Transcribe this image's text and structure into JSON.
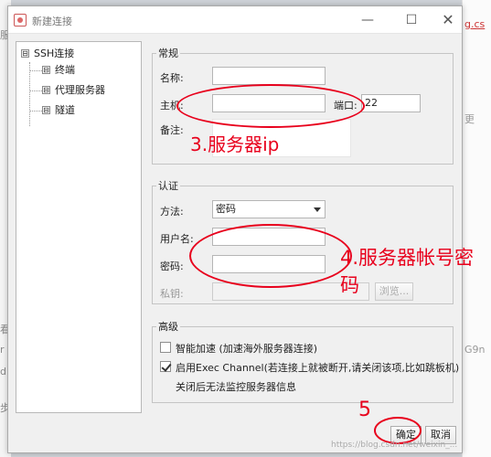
{
  "dialog": {
    "title": "新建连接",
    "buttons": {
      "minimize": "—",
      "maximize": "☐",
      "close": "✕"
    },
    "ok": "确定",
    "cancel": "取消"
  },
  "tree": {
    "root": "SSH连接",
    "children": [
      "终端",
      "代理服务器",
      "隧道"
    ],
    "expander": "⊟"
  },
  "general": {
    "legend": "常规",
    "name_label": "名称:",
    "name_value": "",
    "host_label": "主机:",
    "host_value": "",
    "port_label": "端口:",
    "port_value": "22",
    "note_label": "备注:"
  },
  "auth": {
    "legend": "认证",
    "method_label": "方法:",
    "method_value": "密码",
    "user_label": "用户名:",
    "user_value": "",
    "pass_label": "密码:",
    "pass_value": "",
    "key_label": "私钥:",
    "browse": "浏览..."
  },
  "advanced": {
    "legend": "高级",
    "smart_accel": "智能加速 (加速海外服务器连接)",
    "smart_accel_checked": false,
    "exec_channel": "启用Exec Channel(若连接上就被断开,请关闭该项,比如跳板机)",
    "exec_channel_checked": true,
    "exec_note": "关闭后无法监控服务器信息"
  },
  "annotations": {
    "step3": "3.服务器ip",
    "step4_line1": "4.服务器帐号密",
    "step4_line2": "码",
    "step5": "5",
    "color": "#e8001c"
  },
  "background": {
    "right_top": "g.cs",
    "right_mid": "更",
    "right_bottom": "G9n",
    "left_top": "服",
    "left_a": "看",
    "left_b": "r",
    "left_c": "d",
    "left_bottom": "步"
  },
  "watermark": "https://blog.csdn.net/weixin_..."
}
